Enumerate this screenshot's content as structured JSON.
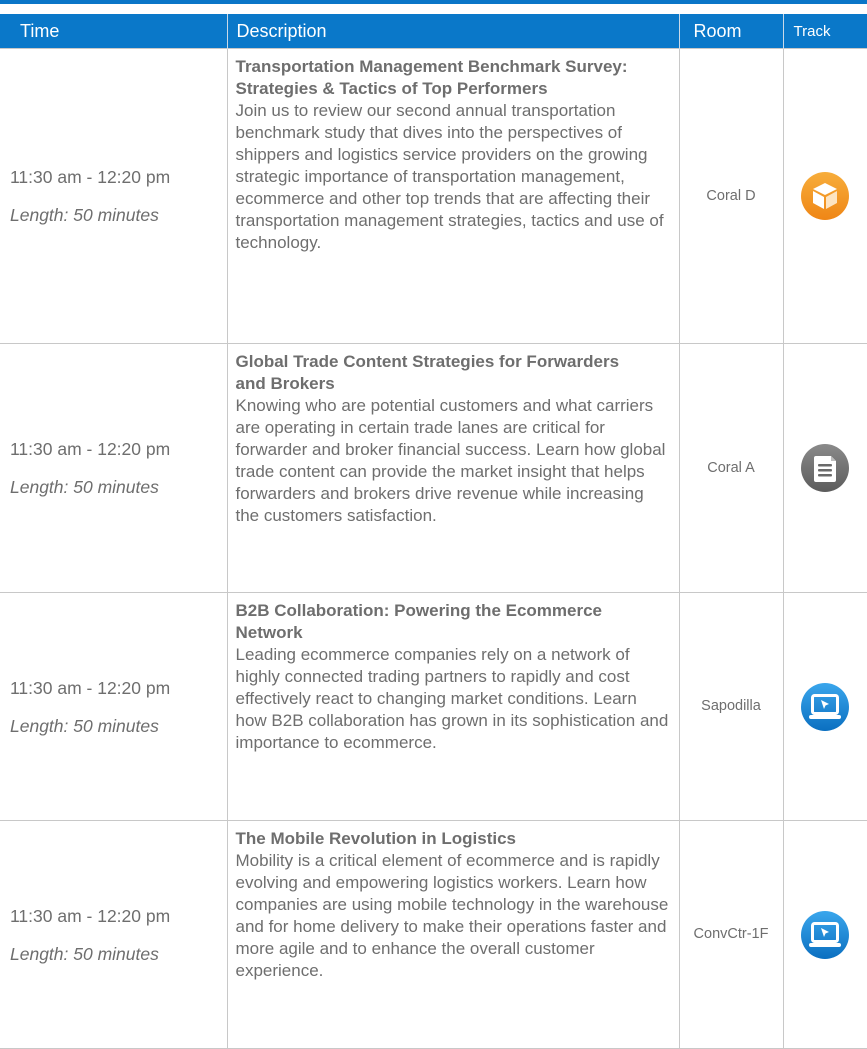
{
  "header": {
    "time": "Time",
    "description": "Description",
    "room": "Room",
    "track": "Track"
  },
  "sessions": [
    {
      "time": "11:30 am - 12:20 pm",
      "length": "Length: 50 minutes",
      "title": "Transportation Management Benchmark Survey: Strategies & Tactics of Top Performers",
      "body": "Join us to review our second annual transportation benchmark study that dives into the perspectives of shippers and logistics service providers on the growing strategic importance of transportation management, ecommerce and other top trends that are affecting their transportation management strategies, tactics and use of technology.",
      "room": "Coral D",
      "track_icon": "box-icon",
      "track_color": "#f39a1e"
    },
    {
      "time": "11:30 am - 12:20 pm",
      "length": "Length: 50 minutes",
      "title": "Global Trade Content Strategies for Forwarders and Brokers",
      "body": "Knowing who are potential customers and what carriers are operating in certain trade lanes are critical for forwarder and broker financial success. Learn how global trade content can provide the market insight that helps forwarders and brokers drive revenue while increasing the customers satisfaction.",
      "room": "Coral A",
      "track_icon": "document-icon",
      "track_color": "#6f6f6f"
    },
    {
      "time": "11:30 am - 12:20 pm",
      "length": "Length: 50 minutes",
      "title": "B2B Collaboration: Powering the Ecommerce Network",
      "body": "Leading ecommerce companies rely on a network of highly connected trading partners to rapidly and cost effectively react to changing market conditions. Learn how B2B collaboration has grown in its sophistication and importance to ecommerce.",
      "room": "Sapodilla",
      "track_icon": "laptop-icon",
      "track_color": "#1a8ad6"
    },
    {
      "time": "11:30 am - 12:20 pm",
      "length": "Length: 50 minutes",
      "title": "The Mobile Revolution in Logistics",
      "body": "Mobility is a critical element of ecommerce and is rapidly evolving and empowering logistics workers. Learn how companies are using mobile technology in the warehouse and for home delivery to make their operations faster and more agile and to enhance the overall customer experience.",
      "room": "ConvCtr-1F",
      "track_icon": "laptop-icon",
      "track_color": "#1a8ad6"
    }
  ]
}
